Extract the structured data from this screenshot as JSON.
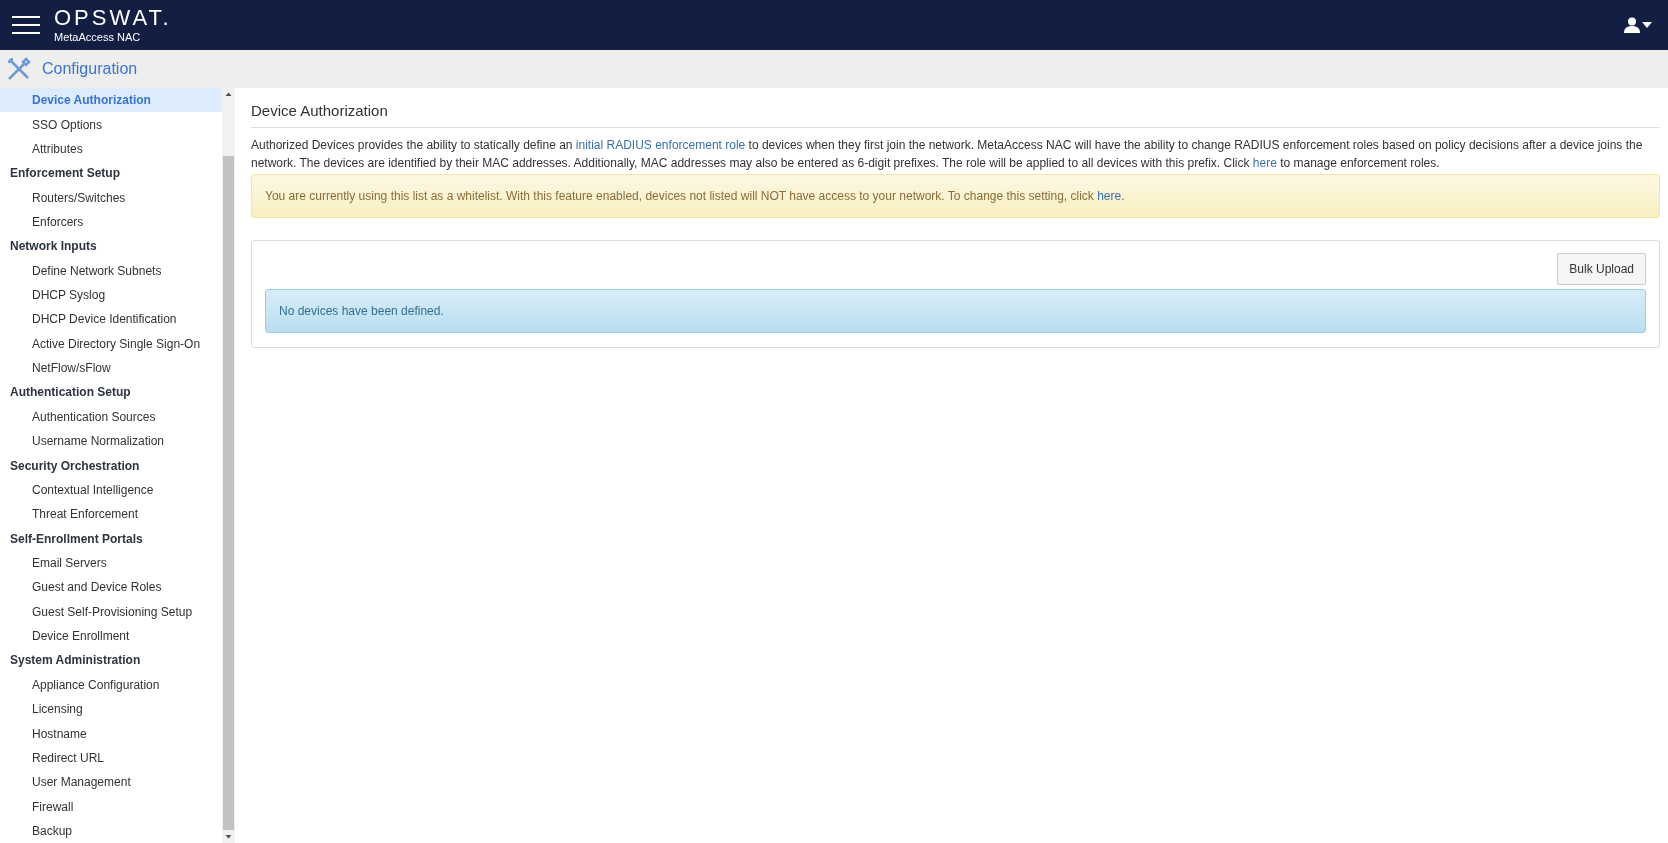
{
  "header": {
    "brand": "OPSWAT.",
    "product": "MetaAccess NAC"
  },
  "section_bar": {
    "title": "Configuration"
  },
  "sidebar": {
    "items": [
      {
        "kind": "link",
        "label": "Device Authorization",
        "selected": true
      },
      {
        "kind": "link",
        "label": "SSO Options",
        "selected": false
      },
      {
        "kind": "link",
        "label": "Attributes",
        "selected": false
      },
      {
        "kind": "heading",
        "label": "Enforcement Setup",
        "selected": false
      },
      {
        "kind": "link",
        "label": "Routers/Switches",
        "selected": false
      },
      {
        "kind": "link",
        "label": "Enforcers",
        "selected": false
      },
      {
        "kind": "heading",
        "label": "Network Inputs",
        "selected": false
      },
      {
        "kind": "link",
        "label": "Define Network Subnets",
        "selected": false
      },
      {
        "kind": "link",
        "label": "DHCP Syslog",
        "selected": false
      },
      {
        "kind": "link",
        "label": "DHCP Device Identification",
        "selected": false
      },
      {
        "kind": "link",
        "label": "Active Directory Single Sign-On",
        "selected": false
      },
      {
        "kind": "link",
        "label": "NetFlow/sFlow",
        "selected": false
      },
      {
        "kind": "heading",
        "label": "Authentication Setup",
        "selected": false
      },
      {
        "kind": "link",
        "label": "Authentication Sources",
        "selected": false
      },
      {
        "kind": "link",
        "label": "Username Normalization",
        "selected": false
      },
      {
        "kind": "heading",
        "label": "Security Orchestration",
        "selected": false
      },
      {
        "kind": "link",
        "label": "Contextual Intelligence",
        "selected": false
      },
      {
        "kind": "link",
        "label": "Threat Enforcement",
        "selected": false
      },
      {
        "kind": "heading",
        "label": "Self-Enrollment Portals",
        "selected": false
      },
      {
        "kind": "link",
        "label": "Email Servers",
        "selected": false
      },
      {
        "kind": "link",
        "label": "Guest and Device Roles",
        "selected": false
      },
      {
        "kind": "link",
        "label": "Guest Self-Provisioning Setup",
        "selected": false
      },
      {
        "kind": "link",
        "label": "Device Enrollment",
        "selected": false
      },
      {
        "kind": "heading",
        "label": "System Administration",
        "selected": false
      },
      {
        "kind": "link",
        "label": "Appliance Configuration",
        "selected": false
      },
      {
        "kind": "link",
        "label": "Licensing",
        "selected": false
      },
      {
        "kind": "link",
        "label": "Hostname",
        "selected": false
      },
      {
        "kind": "link",
        "label": "Redirect URL",
        "selected": false
      },
      {
        "kind": "link",
        "label": "User Management",
        "selected": false
      },
      {
        "kind": "link",
        "label": "Firewall",
        "selected": false
      },
      {
        "kind": "link",
        "label": "Backup",
        "selected": false
      }
    ]
  },
  "main": {
    "title": "Device Authorization",
    "description": [
      {
        "kind": "text",
        "text": "Authorized Devices provides the ability to statically define an "
      },
      {
        "kind": "link",
        "text": "initial RADIUS enforcement role"
      },
      {
        "kind": "text",
        "text": " to devices when they first join the network. MetaAccess NAC will have the ability to change RADIUS enforcement roles based on policy decisions after a device joins the network. The devices are identified by their MAC addresses. Additionally, MAC addresses may also be entered as 6-digit prefixes. The role will be applied to all devices with this prefix. Click "
      },
      {
        "kind": "link",
        "text": "here"
      },
      {
        "kind": "text",
        "text": " to manage enforcement roles."
      }
    ],
    "warning": [
      {
        "kind": "text",
        "text": "You are currently using this list as a whitelist. With this feature enabled, devices not listed will NOT have access to your network. To change this setting, click "
      },
      {
        "kind": "link",
        "text": "here"
      },
      {
        "kind": "text",
        "text": "."
      }
    ],
    "bulk_button": "Bulk Upload",
    "empty_message": "No devices have been defined."
  }
}
